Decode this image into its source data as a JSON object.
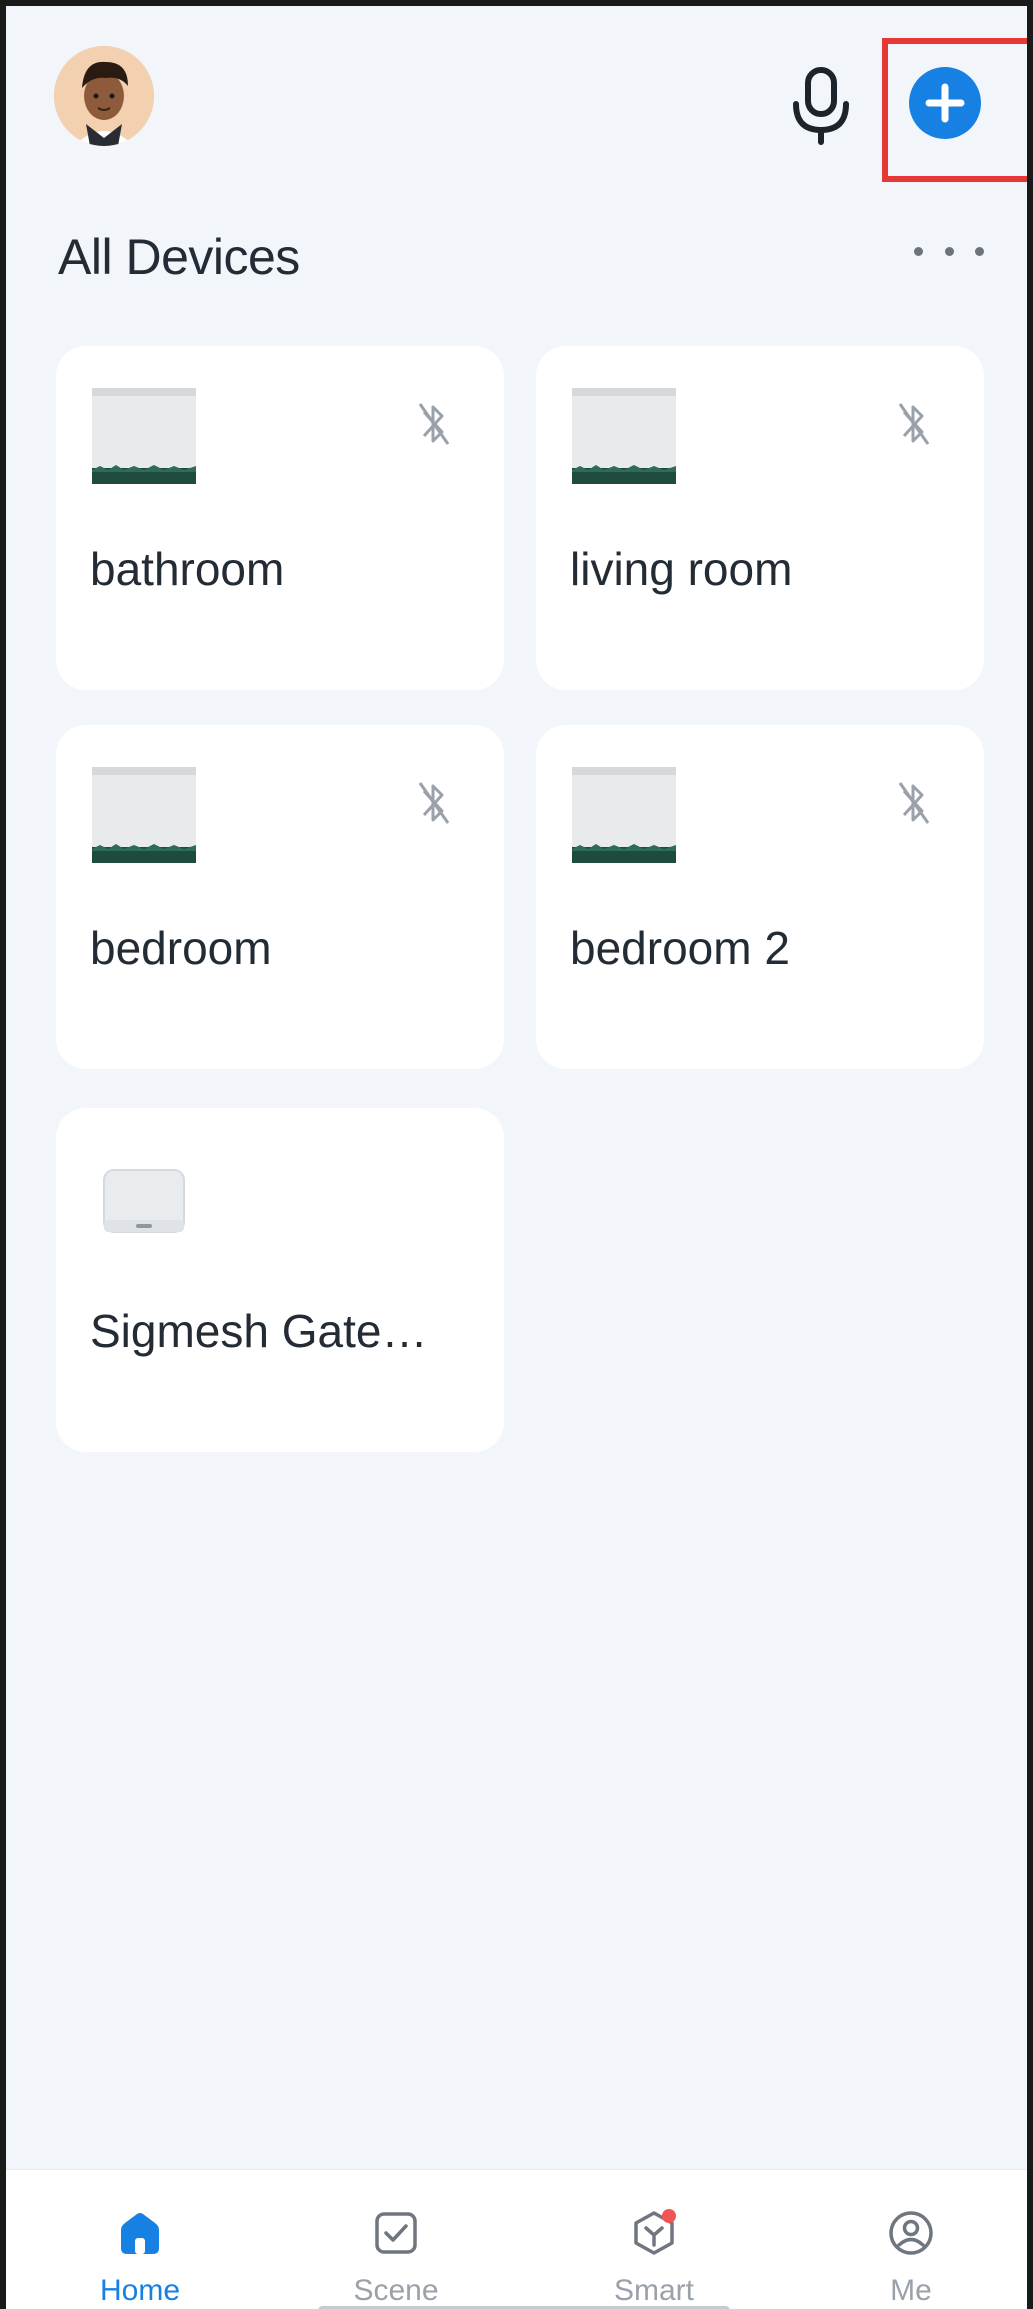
{
  "header": {
    "title": "All Devices",
    "icons": {
      "avatar": "user-avatar",
      "mic": "microphone-icon",
      "add": "plus-circle-icon",
      "more": "more-horizontal-icon"
    }
  },
  "devices": [
    {
      "name": "bathroom",
      "thumb": "curtain-device-image",
      "status_icon": "bluetooth-off-icon"
    },
    {
      "name": "living room",
      "thumb": "curtain-device-image",
      "status_icon": "bluetooth-off-icon"
    },
    {
      "name": "bedroom",
      "thumb": "curtain-device-image",
      "status_icon": "bluetooth-off-icon"
    },
    {
      "name": "bedroom 2",
      "thumb": "curtain-device-image",
      "status_icon": "bluetooth-off-icon"
    },
    {
      "name": "Sigmesh Gate…",
      "thumb": "gateway-device-image"
    }
  ],
  "nav": [
    {
      "label": "Home",
      "icon": "home-icon",
      "active": true
    },
    {
      "label": "Scene",
      "icon": "scene-checkbox-icon",
      "active": false
    },
    {
      "label": "Smart",
      "icon": "smart-cube-icon",
      "active": false,
      "badge": true
    },
    {
      "label": "Me",
      "icon": "profile-icon",
      "active": false
    }
  ],
  "colors": {
    "accent": "#1780e3",
    "highlight": "#e53935",
    "background": "#f2f5f9",
    "badge": "#f05454"
  }
}
